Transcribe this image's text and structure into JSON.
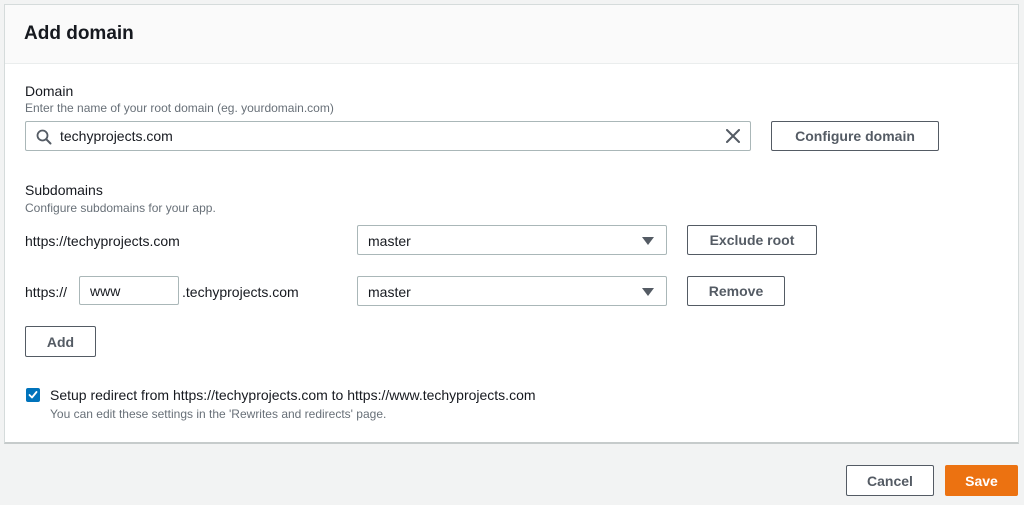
{
  "dialog": {
    "title": "Add domain"
  },
  "domain": {
    "label": "Domain",
    "description": "Enter the name of your root domain (eg. yourdomain.com)",
    "search_value": "techyprojects.com",
    "configure_button": "Configure domain"
  },
  "subdomains": {
    "label": "Subdomains",
    "description": "Configure subdomains for your app.",
    "rows": [
      {
        "url": "https://techyprojects.com",
        "branch": "master",
        "action": "Exclude root"
      },
      {
        "prefix": "https://",
        "subdomain_value": "www",
        "suffix": ".techyprojects.com",
        "branch": "master",
        "action": "Remove"
      }
    ],
    "add_button": "Add"
  },
  "redirect": {
    "checked": true,
    "label": "Setup redirect from https://techyprojects.com to https://www.techyprojects.com",
    "hint": "You can edit these settings in the 'Rewrites and redirects' page."
  },
  "footer": {
    "cancel_button": "Cancel",
    "save_button": "Save"
  },
  "colors": {
    "primary": "#ec7211",
    "checkbox": "#0073bb"
  },
  "icons": {
    "search": "search-icon",
    "clear": "close-icon",
    "select": "caret-down-icon",
    "check": "check-icon"
  }
}
